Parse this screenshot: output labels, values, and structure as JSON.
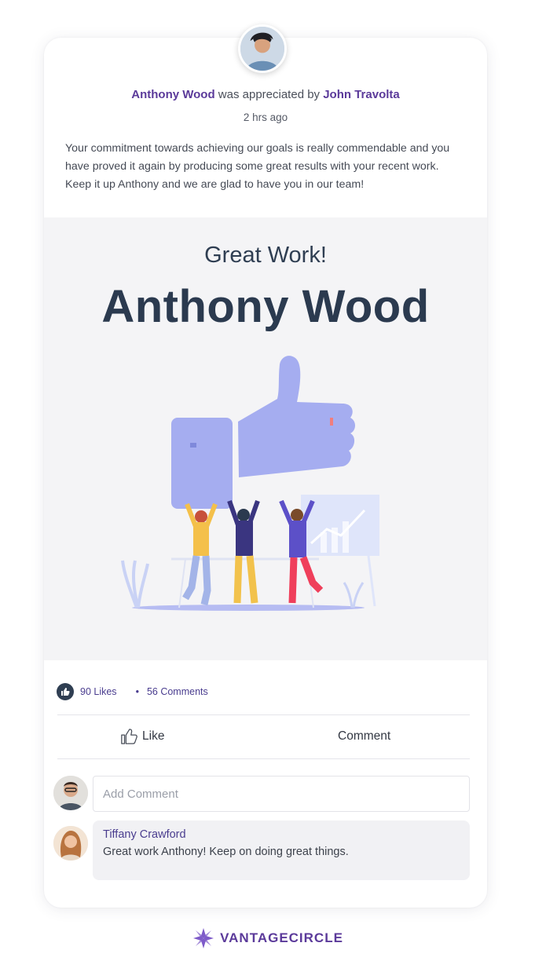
{
  "post": {
    "recipient": "Anthony Wood",
    "appreciated_by_text": "was appreciated by",
    "giver": "John Travolta",
    "time": "2 hrs ago",
    "message": "Your commitment towards achieving our goals is really commendable and you have proved it again by producing some great results with your recent work. Keep it up Anthony and we are glad to have you in our team!"
  },
  "banner": {
    "subtitle": "Great Work!",
    "name": "Anthony Wood"
  },
  "stats": {
    "likes": "90 Likes",
    "comments": "56 Comments"
  },
  "actions": {
    "like_label": "Like",
    "comment_label": "Comment"
  },
  "comment_box": {
    "placeholder": "Add Comment"
  },
  "comments": [
    {
      "author": "Tiffany Crawford",
      "text": "Great work Anthony! Keep on doing great things."
    }
  ],
  "brand": {
    "name": "VANTAGECIRCLE"
  },
  "colors": {
    "accent_purple": "#5b3a9a",
    "dark_navy": "#2b3a4f",
    "illustration_blue": "#a5adf0",
    "banner_bg": "#f4f4f6"
  }
}
